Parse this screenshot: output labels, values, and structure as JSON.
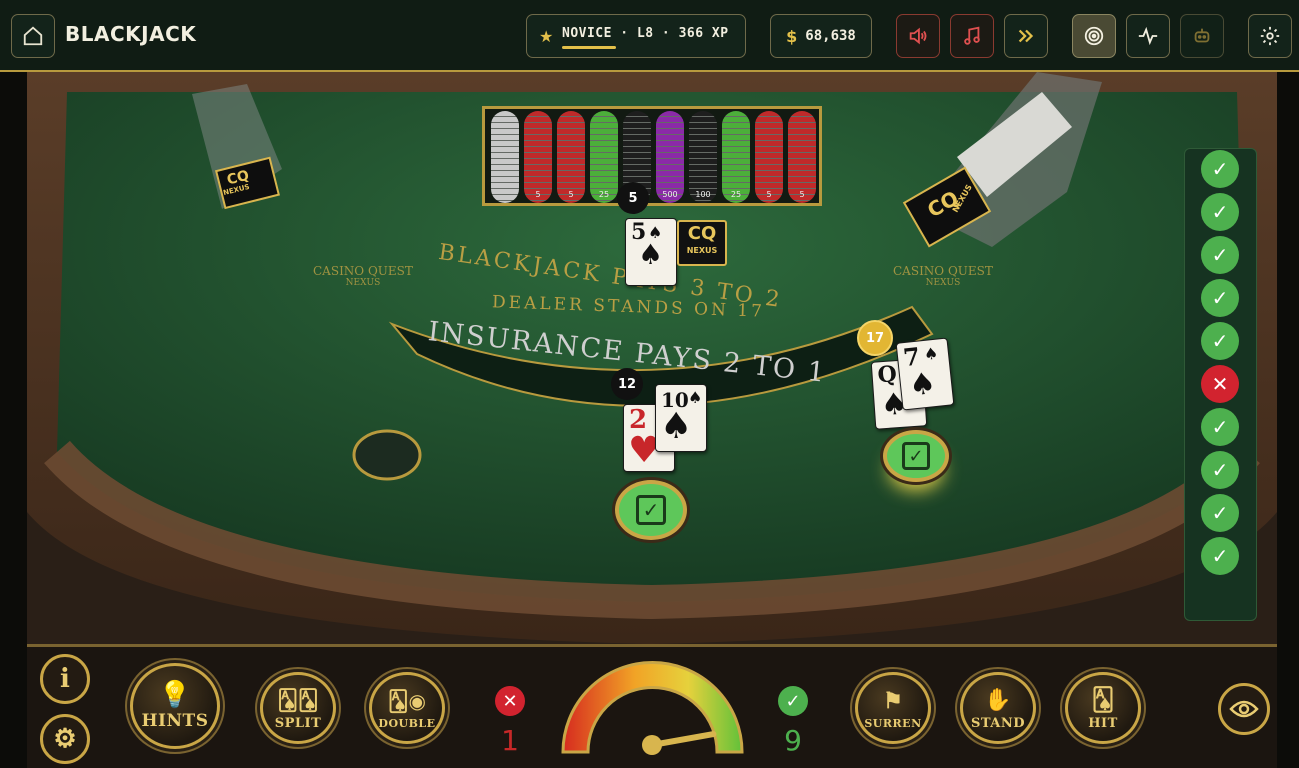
{
  "header": {
    "title": "BLACKJACK",
    "rank_label": "NOVICE · L8 · 366 XP",
    "xp_progress": 0.3,
    "currency_symbol": "$",
    "balance": "68,638",
    "icons": [
      "home-icon",
      "speaker-icon",
      "music-icon",
      "fast-forward-icon",
      "target-icon",
      "pulse-icon",
      "robot-icon",
      "gear-icon"
    ]
  },
  "table": {
    "dealer_total": "5",
    "dealer_cards": [
      {
        "rank": "5",
        "suit": "♠",
        "color": "black"
      }
    ],
    "dealer_hole_card_text": "CQ",
    "dealer_hole_card_sub": "NEXUS",
    "player_hands": [
      {
        "total": "12",
        "cards": [
          {
            "rank": "2",
            "suit": "♥",
            "color": "red"
          },
          {
            "rank": "10",
            "suit": "♠",
            "color": "black"
          }
        ]
      },
      {
        "total": "17",
        "cards": [
          {
            "rank": "Q",
            "suit": "♠",
            "color": "black"
          },
          {
            "rank": "7",
            "suit": "♠",
            "color": "black"
          }
        ]
      }
    ],
    "felt_line_1": "BLACKJACK PAYS 3 TO 2",
    "felt_line_2": "DEALER STANDS ON 17",
    "felt_banner": "INSURANCE PAYS 2 TO 1",
    "logo_text": "CASINO QUEST",
    "logo_sub": "NEXUS",
    "discard_logo": "CQ",
    "discard_logo_sub": "NEXUS",
    "shoe_logo": "CQ",
    "shoe_logo_sub": "NEXUS",
    "chip_rack": [
      {
        "color": "#c9c9c9",
        "value": ""
      },
      {
        "color": "#c02a2a",
        "value": "5"
      },
      {
        "color": "#c02a2a",
        "value": "5"
      },
      {
        "color": "#4caf3a",
        "value": "25"
      },
      {
        "color": "#1e1e1e",
        "value": "100"
      },
      {
        "color": "#8b2aa8",
        "value": "500"
      },
      {
        "color": "#1e1e1e",
        "value": "100"
      },
      {
        "color": "#4caf3a",
        "value": "25"
      },
      {
        "color": "#c02a2a",
        "value": "5"
      },
      {
        "color": "#c02a2a",
        "value": "5"
      }
    ]
  },
  "results": [
    "win",
    "win",
    "win",
    "win",
    "win",
    "loss",
    "win",
    "win",
    "win",
    "win"
  ],
  "controls": {
    "info_label": "i",
    "hints_label": "HINTS",
    "split_label": "SPLIT",
    "double_label": "DOUBLE",
    "surrender_label": "SURREN",
    "stand_label": "STAND",
    "hit_label": "HIT",
    "wrong_count": "1",
    "right_count": "9",
    "gauge_value": 0.88
  },
  "colors": {
    "felt": "#1f4a2c",
    "gold": "#c9a646",
    "win": "#4db04e",
    "loss": "#d2232f"
  }
}
